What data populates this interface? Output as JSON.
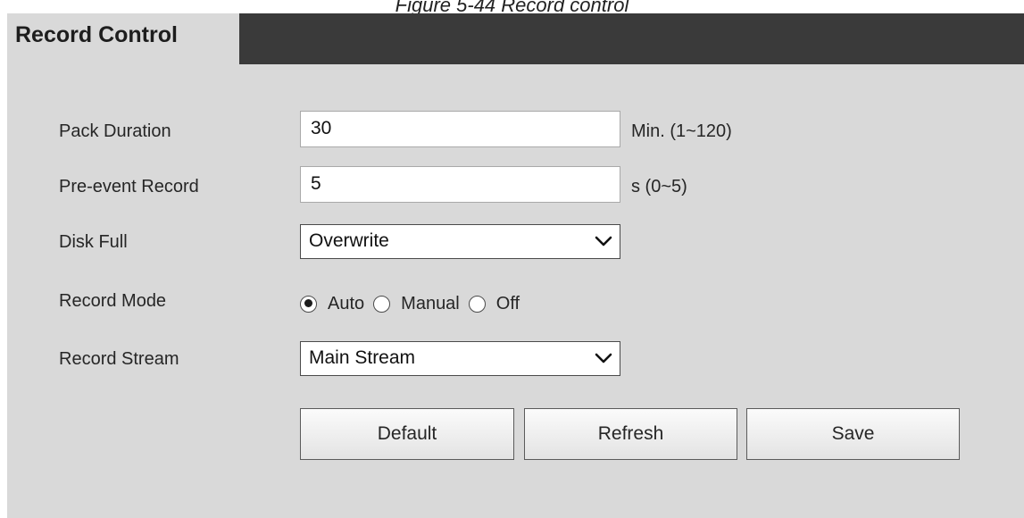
{
  "figure_caption": "Figure 5-44 Record control",
  "tab": {
    "title": "Record Control"
  },
  "form": {
    "pack_duration": {
      "label": "Pack Duration",
      "value": "30",
      "unit": "Min. (1~120)"
    },
    "pre_event_record": {
      "label": "Pre-event Record",
      "value": "5",
      "unit": "s (0~5)"
    },
    "disk_full": {
      "label": "Disk Full",
      "selected": "Overwrite",
      "icon": "chevron-down-icon"
    },
    "record_mode": {
      "label": "Record Mode",
      "options": [
        {
          "label": "Auto",
          "checked": true
        },
        {
          "label": "Manual",
          "checked": false
        },
        {
          "label": "Off",
          "checked": false
        }
      ]
    },
    "record_stream": {
      "label": "Record Stream",
      "selected": "Main Stream",
      "icon": "chevron-down-icon"
    }
  },
  "buttons": {
    "default": "Default",
    "refresh": "Refresh",
    "save": "Save"
  },
  "colors": {
    "header_dark": "#3a3a3a",
    "panel_bg": "#d9d9d9"
  }
}
